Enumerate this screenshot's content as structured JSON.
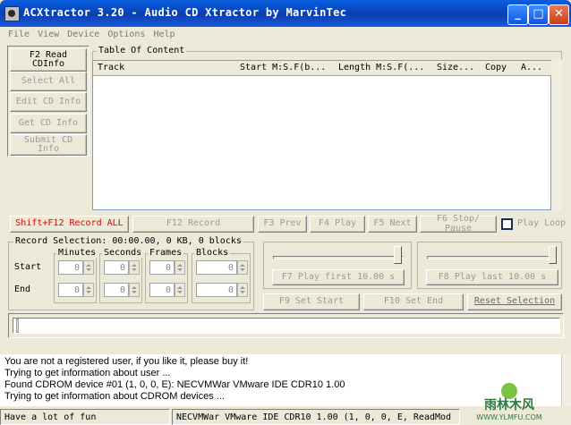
{
  "window": {
    "title": "ACXtractor 3.20 - Audio CD Xtractor by MarvinTec"
  },
  "menu": [
    "File",
    "View",
    "Device",
    "Options",
    "Help"
  ],
  "left_buttons": {
    "read_cdinfo": "F2 Read CDInfo",
    "select_all": "Select All",
    "edit_cd_info": "Edit CD Info",
    "get_cd_info": "Get CD Info",
    "submit_cd_info": "Submit CD Info"
  },
  "toc": {
    "label": "Table Of Content",
    "columns": [
      "Track",
      "Start M:S.F(b...",
      "Length M:S.F(...",
      "Size...",
      "Copy",
      "A..."
    ]
  },
  "toolbar": {
    "record_all": "Shift+F12 Record ALL",
    "record": "F12 Record",
    "prev": "F3 Prev",
    "play": "F4 Play",
    "next": "F5 Next",
    "stop_pause": "F6 Stop/ Pause",
    "play_loop": "Play Loop"
  },
  "record_selection": {
    "label": "Record Selection: 00:00.00, 0 KB, 0 blocks",
    "columns": [
      "Minutes",
      "Seconds",
      "Frames",
      "Blocks"
    ],
    "rows": [
      {
        "label": "Start",
        "values": [
          "0",
          "0",
          "0",
          "0"
        ]
      },
      {
        "label": "End",
        "values": [
          "0",
          "0",
          "0",
          "0"
        ]
      }
    ]
  },
  "play_first": "F7 Play first 10.00 s",
  "play_last": "F8 Play last 10.00 s",
  "set_start": "F9 Set Start",
  "set_end": "F10 Set End",
  "reset_selection": "Reset Selection",
  "log": [
    "You are not a registered user, if you like it, please buy it!",
    "Trying to get information about user ...",
    "Found CDROM device #01 (1, 0, 0, E): NECVMWar VMware IDE CDR10 1.00",
    "Trying to get information about CDROM devices ..."
  ],
  "statusbar": {
    "message": "Have a lot of fun",
    "device": "NECVMWar VMware IDE CDR10 1.00 (1, 0, 0, E, ReadMod"
  },
  "watermark": "雨林木风 WWW.YLMFU.COM"
}
